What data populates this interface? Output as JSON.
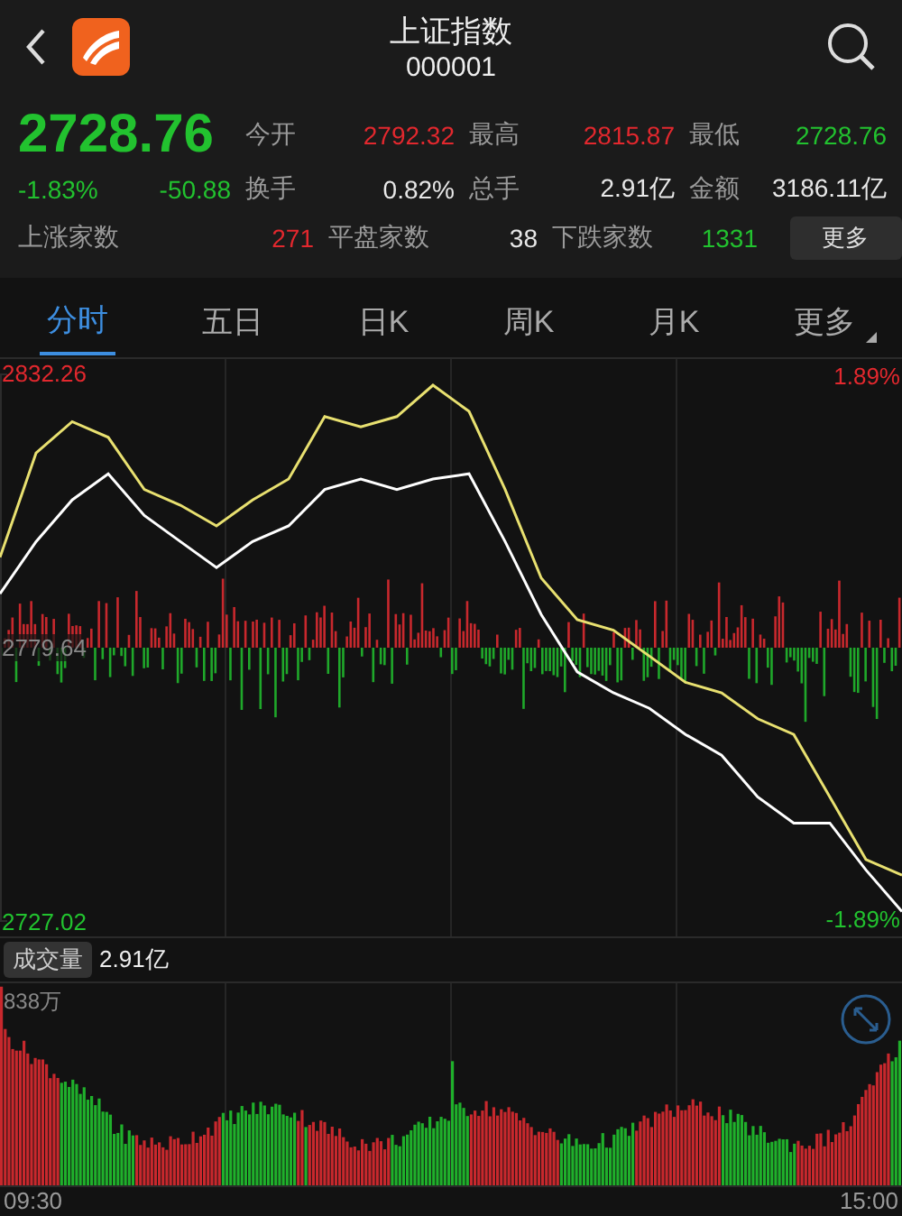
{
  "header": {
    "title": "上证指数",
    "code": "000001"
  },
  "quote": {
    "price": "2728.76",
    "change_pct": "-1.83%",
    "change": "-50.88",
    "color": "#22c22f"
  },
  "stats": [
    {
      "label": "今开",
      "value": "2792.32",
      "color": "#e2282e"
    },
    {
      "label": "最高",
      "value": "2815.87",
      "color": "#e2282e"
    },
    {
      "label": "最低",
      "value": "2728.76",
      "color": "#22c22f"
    },
    {
      "label": "换手",
      "value": "0.82%",
      "color": "#e8e8e8"
    },
    {
      "label": "总手",
      "value": "2.91亿",
      "color": "#e8e8e8"
    },
    {
      "label": "金额",
      "value": "3186.11亿",
      "color": "#e8e8e8"
    }
  ],
  "breadth": [
    {
      "label": "上涨家数",
      "value": "271",
      "color": "#e2282e"
    },
    {
      "label": "平盘家数",
      "value": "38",
      "color": "#e8e8e8"
    },
    {
      "label": "下跌家数",
      "value": "1331",
      "color": "#22c22f"
    }
  ],
  "more_button": "更多",
  "tabs": [
    {
      "label": "分时",
      "selected": true,
      "kind": "view"
    },
    {
      "label": "五日",
      "selected": false,
      "kind": "view"
    },
    {
      "label": "日K",
      "selected": false,
      "kind": "view"
    },
    {
      "label": "周K",
      "selected": false,
      "kind": "view"
    },
    {
      "label": "月K",
      "selected": false,
      "kind": "view"
    },
    {
      "label": "更多",
      "selected": false,
      "kind": "menu"
    }
  ],
  "price_chart": {
    "percent_labels": [
      {
        "label": "1.89%",
        "color": "#e2282e"
      },
      {
        "label": "-1.89%",
        "color": "#22c22f"
      }
    ],
    "chart_data": {
      "type": "line",
      "yticks": [
        {
          "value": 2832.26,
          "label": "2832.26"
        },
        {
          "value": 2779.64,
          "label": "2779.64"
        },
        {
          "value": 2727.02,
          "label": "2727.02"
        }
      ],
      "ylim": [
        2727.02,
        2832.26
      ],
      "series": [
        {
          "color": "#ffffff",
          "values": [
            2790,
            2800,
            2808,
            2813,
            2805,
            2800,
            2795,
            2800,
            2803,
            2810,
            2812,
            2810,
            2812,
            2813,
            2800,
            2786,
            2775,
            2771,
            2768,
            2763,
            2759,
            2751,
            2746,
            2746,
            2737,
            2729
          ]
        },
        {
          "color": "#e8e070",
          "values": [
            2797,
            2817,
            2823,
            2820,
            2810,
            2807,
            2803,
            2808,
            2812,
            2824,
            2822,
            2824,
            2830,
            2825,
            2810,
            2793,
            2785,
            2783,
            2778,
            2773,
            2771,
            2766,
            2763,
            2751,
            2739,
            2736
          ]
        }
      ]
    }
  },
  "volume": {
    "label": "成交量",
    "value": "2.91亿",
    "max_label": "838万"
  },
  "time_axis": [
    "09:30",
    "15:00"
  ]
}
